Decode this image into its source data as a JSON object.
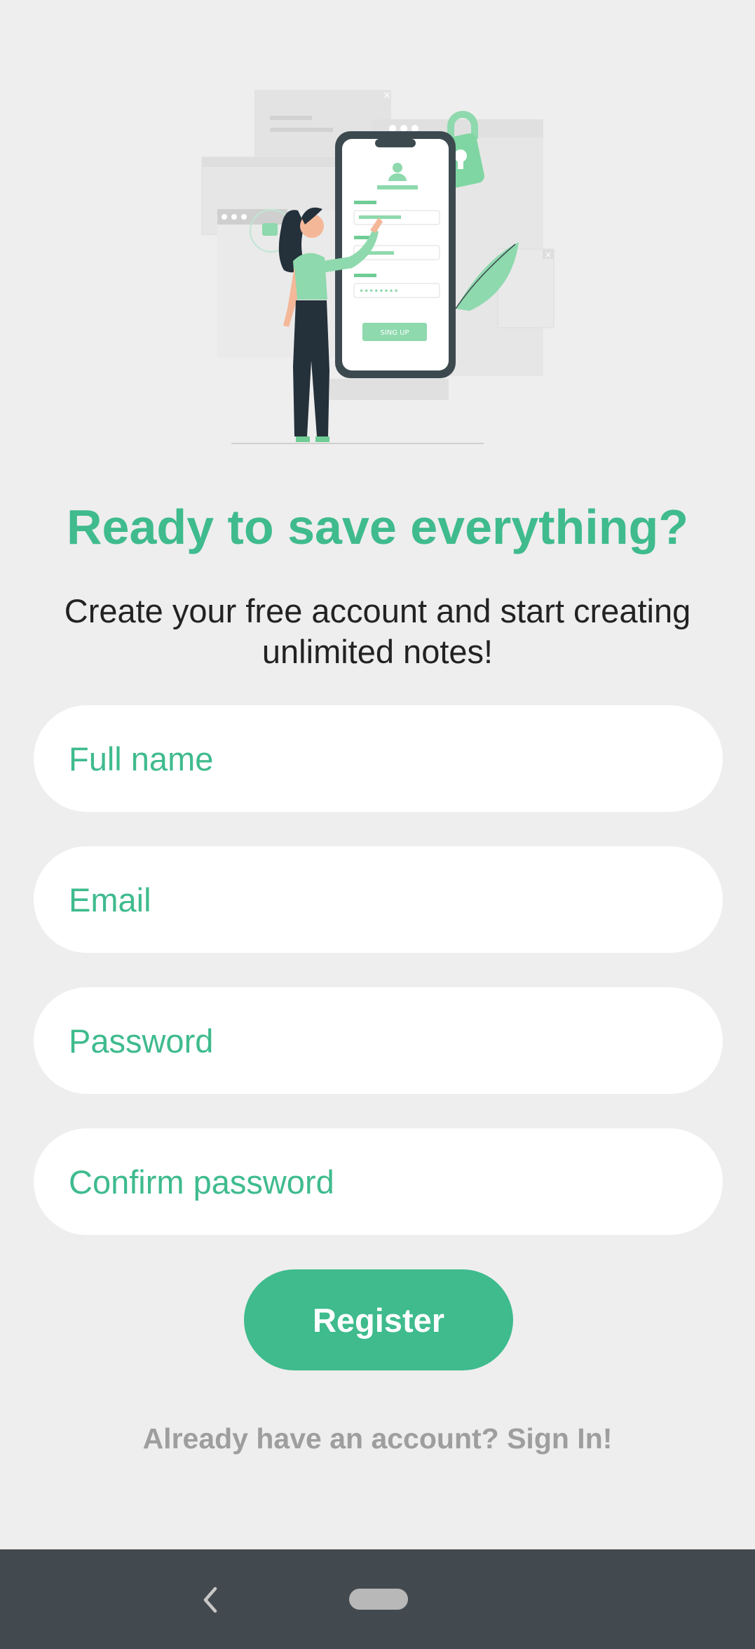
{
  "header": {
    "title": "Ready to save everything?",
    "subtitle": "Create your free account and start creating unlimited notes!"
  },
  "illustration": {
    "icon": "woman-signing-up-on-phone-illustration",
    "phone_button_label": "SING UP",
    "password_dots": "••••••••"
  },
  "form": {
    "full_name": {
      "placeholder": "Full name",
      "value": ""
    },
    "email": {
      "placeholder": "Email",
      "value": ""
    },
    "password": {
      "placeholder": "Password",
      "value": ""
    },
    "confirm_password": {
      "placeholder": "Confirm password",
      "value": ""
    }
  },
  "actions": {
    "register_label": "Register",
    "signin_text": "Already have an account? Sign In!"
  },
  "navbar": {
    "back_icon": "chevron-left-icon",
    "home_icon": "home-pill-icon"
  },
  "colors": {
    "accent": "#3fbb8e",
    "background": "#eeeeee",
    "field": "#ffffff",
    "navbar": "#434a4f",
    "muted_text": "#9e9e9e"
  }
}
